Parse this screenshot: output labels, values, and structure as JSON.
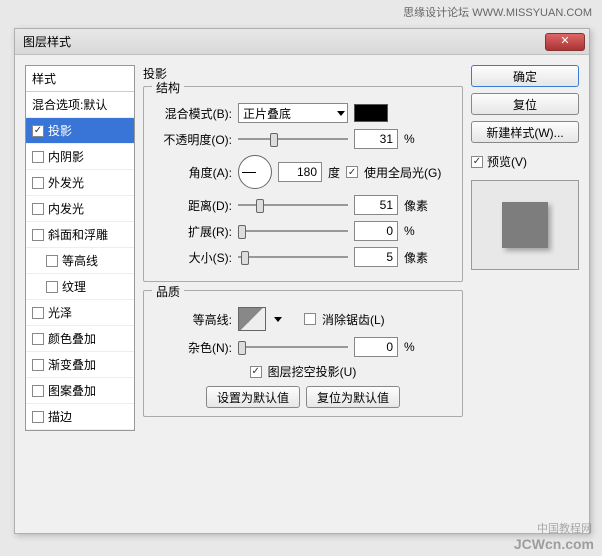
{
  "watermark_top": "思缘设计论坛  WWW.MISSYUAN.COM",
  "dialog_title": "图层样式",
  "styles_panel": {
    "header": "样式",
    "blend_row": "混合选项:默认",
    "items": [
      {
        "label": "投影",
        "checked": true,
        "selected": true
      },
      {
        "label": "内阴影",
        "checked": false
      },
      {
        "label": "外发光",
        "checked": false
      },
      {
        "label": "内发光",
        "checked": false
      },
      {
        "label": "斜面和浮雕",
        "checked": false
      },
      {
        "label": "等高线",
        "checked": false,
        "sub": true
      },
      {
        "label": "纹理",
        "checked": false,
        "sub": true
      },
      {
        "label": "光泽",
        "checked": false
      },
      {
        "label": "颜色叠加",
        "checked": false
      },
      {
        "label": "渐变叠加",
        "checked": false
      },
      {
        "label": "图案叠加",
        "checked": false
      },
      {
        "label": "描边",
        "checked": false
      }
    ]
  },
  "center": {
    "title": "投影",
    "grp_structure": "结构",
    "blend_mode_label": "混合模式(B):",
    "blend_mode_value": "正片叠底",
    "opacity_label": "不透明度(O):",
    "opacity_value": "31",
    "percent": "%",
    "angle_label": "角度(A):",
    "angle_value": "180",
    "degree": "度",
    "global_light_label": "使用全局光(G)",
    "distance_label": "距离(D):",
    "distance_value": "51",
    "px": "像素",
    "spread_label": "扩展(R):",
    "spread_value": "0",
    "size_label": "大小(S):",
    "size_value": "5",
    "grp_quality": "品质",
    "contour_label": "等高线:",
    "antialias_label": "消除锯齿(L)",
    "noise_label": "杂色(N):",
    "noise_value": "0",
    "knockout_label": "图层挖空投影(U)",
    "set_default": "设置为默认值",
    "reset_default": "复位为默认值"
  },
  "right": {
    "ok": "确定",
    "reset": "复位",
    "new_style": "新建样式(W)...",
    "preview_label": "预览(V)"
  },
  "footer_wm2": "中国教程网",
  "footer_wm": "JCWcn.com"
}
